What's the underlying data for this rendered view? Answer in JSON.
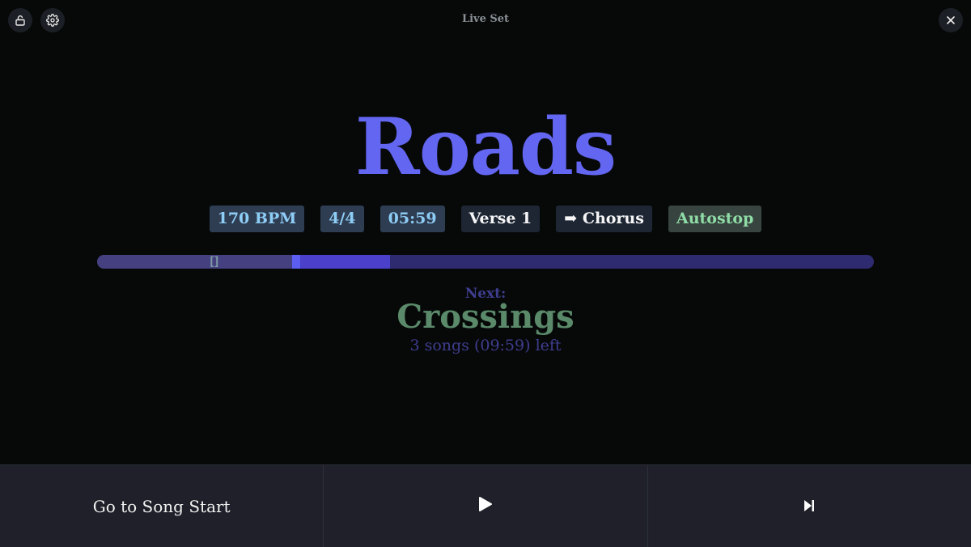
{
  "header": {
    "title": "Live Set",
    "lock_icon": "lock-open-icon",
    "settings_icon": "gear-icon",
    "close_icon": "close-icon"
  },
  "current_song": {
    "title": "Roads",
    "bpm": "170 BPM",
    "time_signature": "4/4",
    "time_remaining": "05:59",
    "current_section": "Verse 1",
    "next_section": "➡ Chorus",
    "mode": "Autostop"
  },
  "progress": {
    "played_fraction": 0.251,
    "current_section_end_fraction": 0.377,
    "loop_marker_fraction": 0.142,
    "loop_marker_glyph": "[]"
  },
  "next": {
    "label": "Next:",
    "title": "Crossings",
    "remaining": "3 songs (09:59) left"
  },
  "controls": {
    "go_to_start_label": "Go to Song Start",
    "play_icon": "play-icon",
    "skip_icon": "skip-next-icon"
  },
  "colors": {
    "accent": "#6366f1",
    "next_title": "#5a8a6a",
    "autostop": "#8fdca6"
  }
}
